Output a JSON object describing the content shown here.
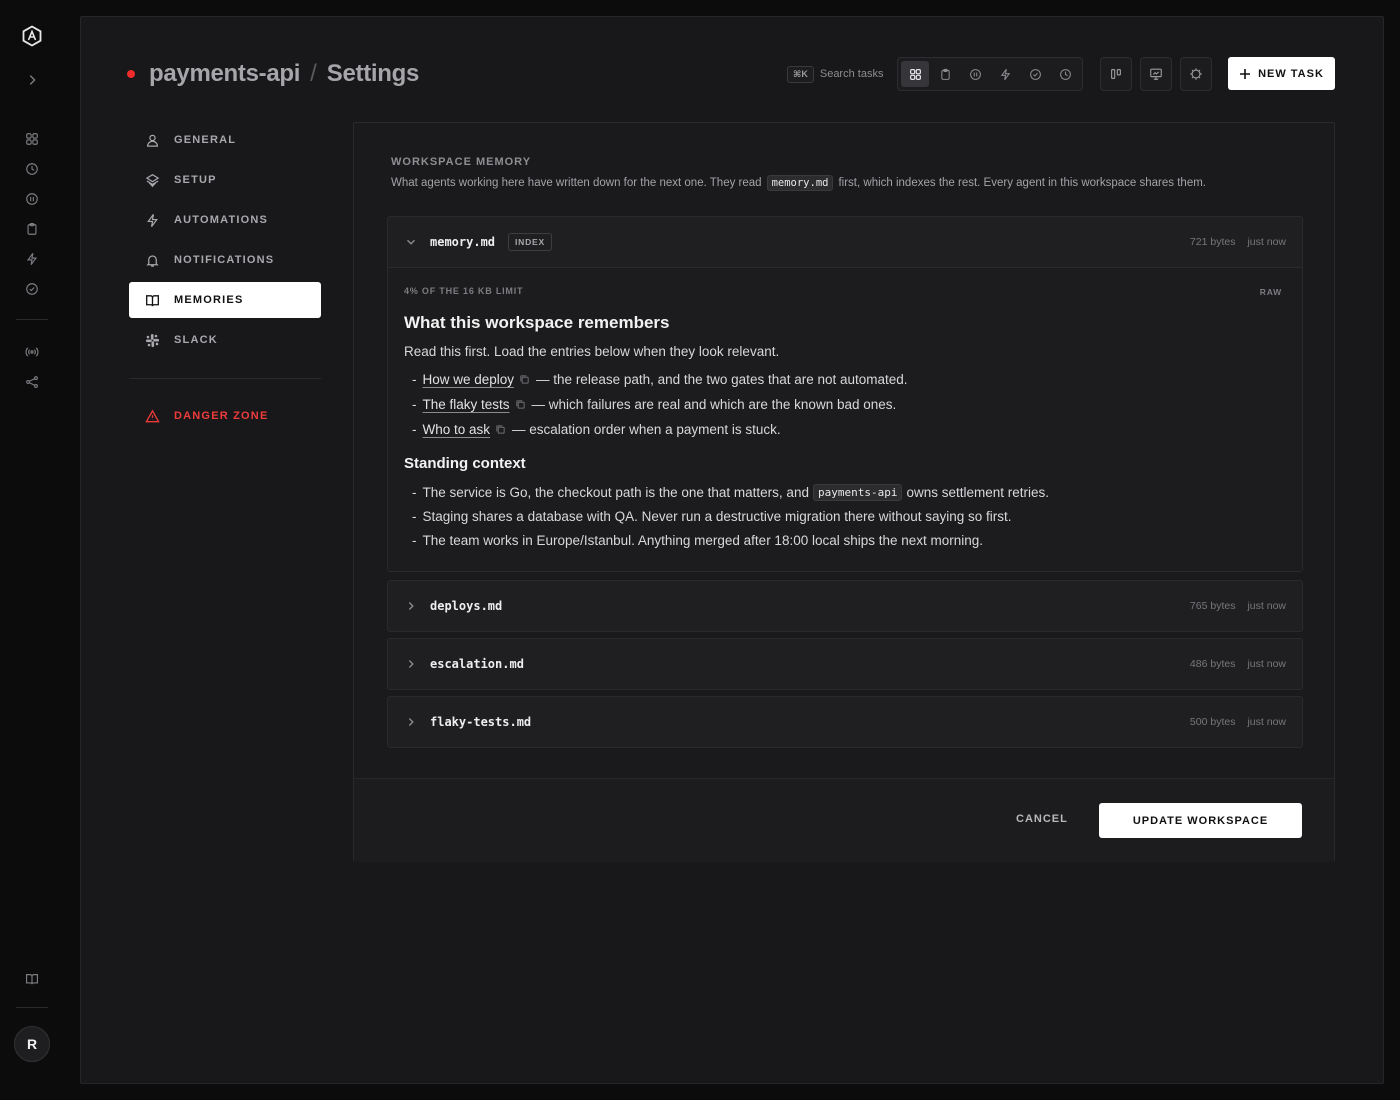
{
  "rail": {
    "icons": [
      "app-logo",
      "expand-icon",
      "board-icon",
      "history-icon",
      "paused-icon",
      "clipboard-icon",
      "bolt-icon",
      "check-circle-icon",
      "broadcast-icon",
      "share-icon",
      "book-icon"
    ],
    "avatar_initial": "R"
  },
  "header": {
    "repo": "payments-api",
    "separator": "/",
    "page": "Settings",
    "status_color": "#ef2b2b",
    "search_shortcut": "⌘K",
    "search_label": "Search tasks",
    "new_task_label": "NEW TASK"
  },
  "settings_nav": {
    "items": [
      {
        "label": "GENERAL",
        "icon": "user-icon"
      },
      {
        "label": "SETUP",
        "icon": "layers-icon"
      },
      {
        "label": "AUTOMATIONS",
        "icon": "bolt-icon"
      },
      {
        "label": "NOTIFICATIONS",
        "icon": "bell-icon"
      },
      {
        "label": "MEMORIES",
        "icon": "book-icon",
        "active": true
      },
      {
        "label": "SLACK",
        "icon": "slack-icon"
      }
    ],
    "danger_label": "DANGER ZONE"
  },
  "memory": {
    "heading": "WORKSPACE MEMORY",
    "desc_before": "What agents working here have written down for the next one. They read",
    "desc_code": "memory.md",
    "desc_after": "first, which indexes the rest. Every agent in this workspace shares them.",
    "files": [
      {
        "name": "memory.md",
        "badge": "INDEX",
        "size": "721 bytes",
        "updated": "just now",
        "expanded": true,
        "limit_label": "4% OF THE 16 KB LIMIT",
        "raw_label": "RAW",
        "h1": "What this workspace remembers",
        "intro": "Read this first. Load the entries below when they look relevant.",
        "links": [
          {
            "text": "How we deploy",
            "rest": "— the release path, and the two gates that are not automated."
          },
          {
            "text": "The flaky tests",
            "rest": "— which failures are real and which are the known bad ones."
          },
          {
            "text": "Who to ask",
            "rest": "— escalation order when a payment is stuck."
          }
        ],
        "h2": "Standing context",
        "context": {
          "item1_before": "The service is Go, the checkout path is the one that matters, and",
          "item1_code": "payments-api",
          "item1_after": "owns settlement retries.",
          "item2": "Staging shares a database with QA. Never run a destructive migration there without saying so first.",
          "item3": "The team works in Europe/Istanbul. Anything merged after 18:00 local ships the next morning."
        }
      },
      {
        "name": "deploys.md",
        "size": "765 bytes",
        "updated": "just now"
      },
      {
        "name": "escalation.md",
        "size": "486 bytes",
        "updated": "just now"
      },
      {
        "name": "flaky-tests.md",
        "size": "500 bytes",
        "updated": "just now"
      }
    ]
  },
  "footer": {
    "cancel_label": "CANCEL",
    "update_label": "UPDATE WORKSPACE"
  }
}
